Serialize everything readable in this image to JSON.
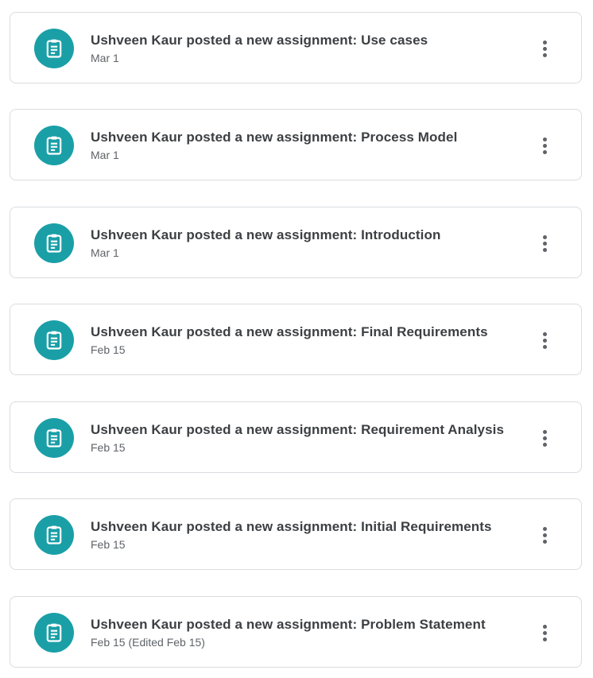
{
  "theme": {
    "accent": "#1a9fa7",
    "icon": "assignment-icon",
    "menu_icon": "more-vert-icon"
  },
  "stream": {
    "items": [
      {
        "title": "Ushveen Kaur posted a new assignment: Use cases",
        "date": "Mar 1"
      },
      {
        "title": "Ushveen Kaur posted a new assignment: Process Model",
        "date": "Mar 1"
      },
      {
        "title": "Ushveen Kaur posted a new assignment: Introduction",
        "date": "Mar 1"
      },
      {
        "title": "Ushveen Kaur posted a new assignment: Final Requirements",
        "date": "Feb 15"
      },
      {
        "title": "Ushveen Kaur posted a new assignment: Requirement Analysis",
        "date": "Feb 15"
      },
      {
        "title": "Ushveen Kaur posted a new assignment: Initial Requirements",
        "date": "Feb 15"
      },
      {
        "title": "Ushveen Kaur posted a new assignment: Problem Statement",
        "date": "Feb 15 (Edited Feb 15)"
      }
    ]
  }
}
